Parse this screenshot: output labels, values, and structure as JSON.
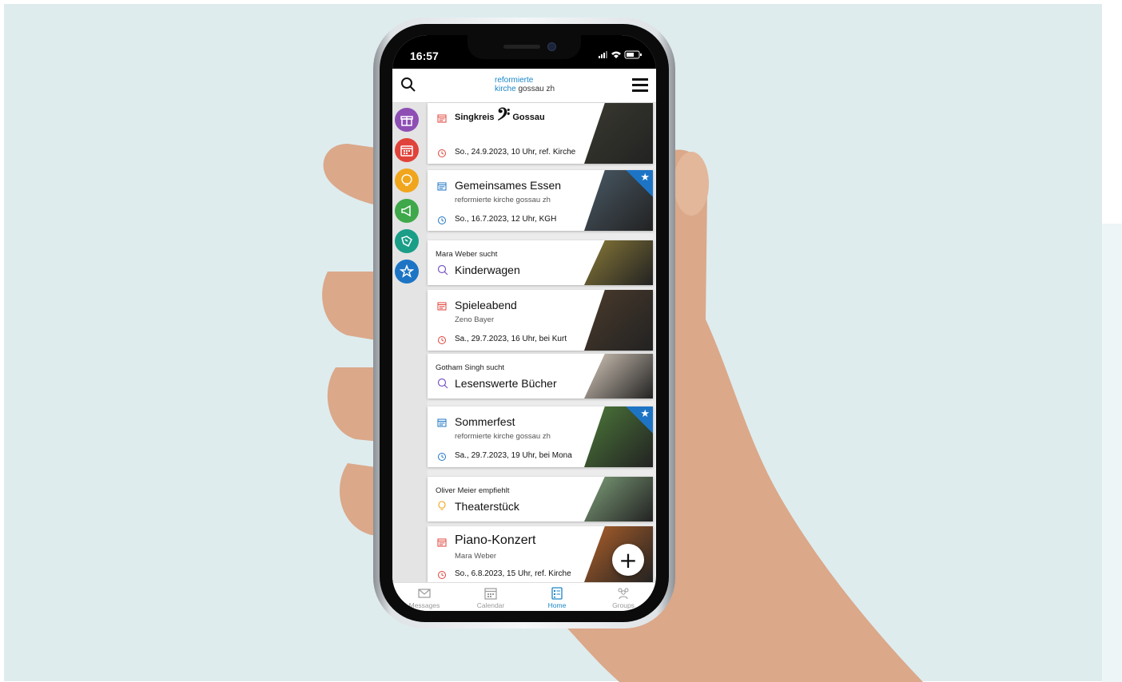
{
  "statusbar": {
    "time": "16:57",
    "indicators": "signal wifi battery"
  },
  "header": {
    "logo_line1": "reformierte",
    "logo_line2_blue": "kirche",
    "logo_line2_rest": " gossau zh"
  },
  "categories": [
    {
      "name": "gift-icon",
      "color": "#8e4fb5"
    },
    {
      "name": "calendar-icon",
      "color": "#e0433a"
    },
    {
      "name": "lightbulb-icon",
      "color": "#f0a51c"
    },
    {
      "name": "megaphone-icon",
      "color": "#3fa84a"
    },
    {
      "name": "handshake-icon",
      "color": "#1a9e88"
    },
    {
      "name": "star-icon",
      "color": "#1d74c4"
    }
  ],
  "cards": [
    {
      "type": "event",
      "title": "Singkreis",
      "title_suffix": "Gossau",
      "clef": "𝄢",
      "date": "So., 24.9.2023, 10 Uhr, ref. Kirche",
      "icon_color": "#e0433a",
      "thumb": "#3a3a30"
    },
    {
      "type": "event",
      "title": "Gemeinsames Essen",
      "subtitle": "reformierte kirche gossau zh",
      "date": "So., 16.7.2023, 12 Uhr, KGH",
      "icon_color": "#1d74c4",
      "starred": true,
      "thumb": "#4a5a66"
    },
    {
      "type": "search",
      "who": "Mara Weber sucht",
      "title": "Kinderwagen",
      "thumb": "#8a7a38"
    },
    {
      "type": "event",
      "title": "Spieleabend",
      "subtitle": "Zeno Bayer",
      "date": "Sa., 29.7.2023, 16 Uhr, bei Kurt",
      "icon_color": "#e0433a",
      "thumb": "#4b3b2c"
    },
    {
      "type": "search",
      "who": "Gotham Singh sucht",
      "title": "Lesenswerte Bücher",
      "thumb": "#d8cbbd"
    },
    {
      "type": "event",
      "title": "Sommerfest",
      "subtitle": "reformierte kirche gossau zh",
      "date": "Sa., 29.7.2023, 19 Uhr, bei Mona",
      "icon_color": "#1d74c4",
      "starred": true,
      "thumb": "#4d7a3a"
    },
    {
      "type": "tip",
      "who": "Oliver Meier empfiehlt",
      "title": "Theaterstück",
      "thumb": "#7fa07a"
    },
    {
      "type": "event",
      "title": "Piano-Konzert",
      "subtitle": "Mara Weber",
      "date": "So., 6.8.2023, 15 Uhr, ref. Kirche",
      "icon_color": "#e0433a",
      "thumb": "#b0612a"
    }
  ],
  "fab_label": "+",
  "tabs": [
    {
      "label": "Messages",
      "icon": "envelope-icon",
      "active": false
    },
    {
      "label": "Calendar",
      "icon": "calendar-icon",
      "active": false
    },
    {
      "label": "Home",
      "icon": "home-list-icon",
      "active": true
    },
    {
      "label": "Groups",
      "icon": "groups-icon",
      "active": false
    }
  ]
}
